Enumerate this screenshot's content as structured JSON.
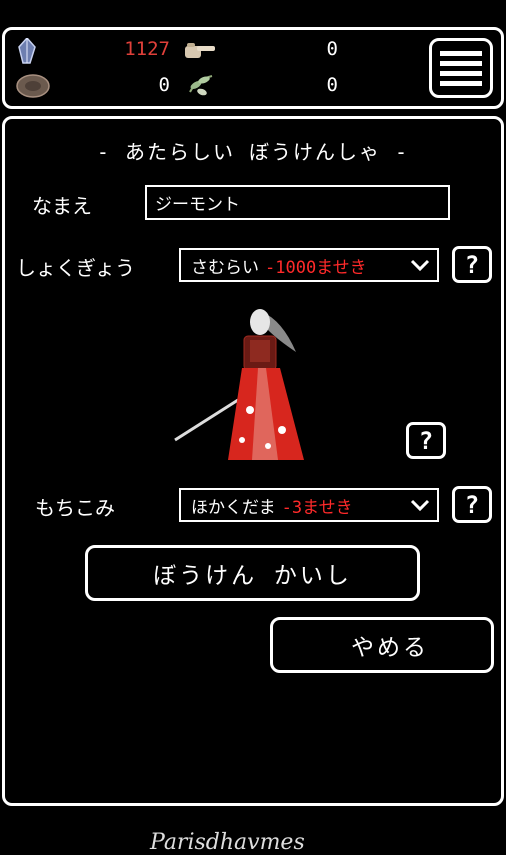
{
  "resources": {
    "crystal": {
      "icon": "crystal-icon",
      "value": "1127",
      "color": "#e0403a"
    },
    "coin": {
      "icon": "stone-coin-icon",
      "value": "0"
    },
    "hand": {
      "icon": "pointing-hand-icon",
      "value": "0"
    },
    "herb": {
      "icon": "herb-icon",
      "value": "0"
    }
  },
  "title": "- あたらしい ぼうけんしゃ -",
  "name_label": "なまえ",
  "name_value": "ジーモント",
  "job_label": "しょくぎょう",
  "job_value": "さむらい",
  "job_cost": "-1000ませき",
  "item_label": "もちこみ",
  "item_value": "ほかくだま",
  "item_cost": "-3ませき",
  "help_label": "?",
  "start_button": "ぼうけん かいし",
  "cancel_button": "やめる",
  "footer_logo": "Parisdhavmes"
}
